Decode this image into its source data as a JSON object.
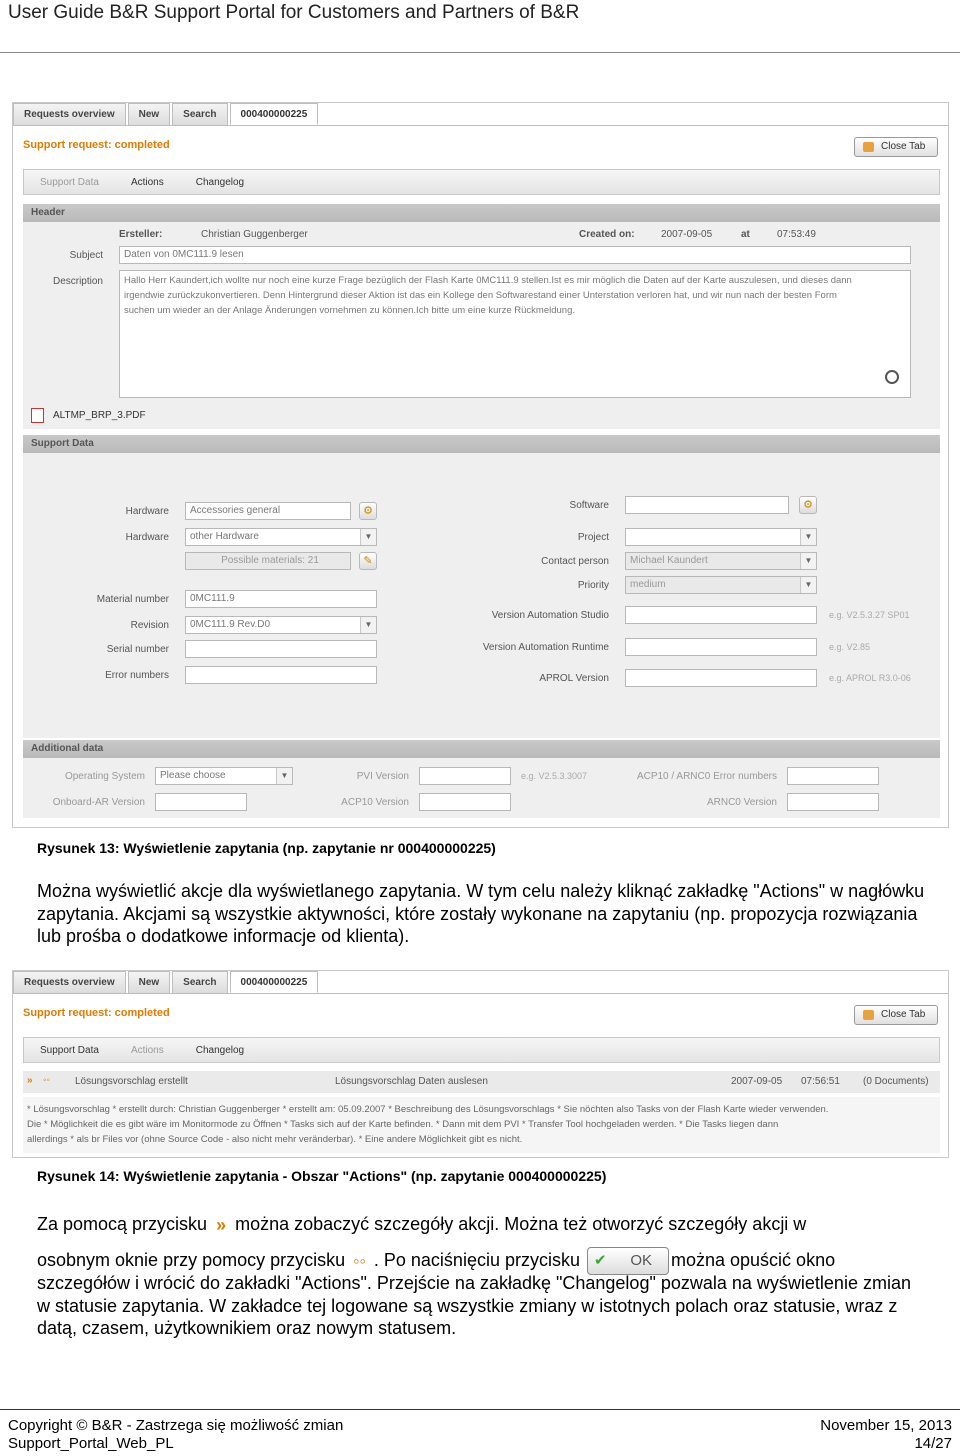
{
  "page_header": "User Guide B&R Support Portal for Customers and Partners of B&R",
  "shot1": {
    "tabs": [
      "Requests overview",
      "New",
      "Search",
      "000400000225"
    ],
    "title": "Support request: completed",
    "close_tab": "Close Tab",
    "subtabs": [
      "Support Data",
      "Actions",
      "Changelog"
    ],
    "header": {
      "bar": "Header",
      "ersteller_label": "Ersteller:",
      "ersteller_value": "Christian Guggenberger",
      "created_label": "Created on:",
      "created_date": "2007-09-05",
      "at_label": "at",
      "created_time": "07:53:49",
      "subject_label": "Subject",
      "subject_value": "Daten von 0MC111.9 lesen",
      "description_label": "Description",
      "description_lines": [
        "Hallo Herr Kaundert,ich wollte nur noch eine kurze Frage bezüglich der Flash Karte 0MC111.9 stellen.Ist es mir möglich die Daten auf der Karte auszulesen, und dieses dann",
        "irgendwie zurückzukonvertieren. Denn Hintergrund dieser Aktion ist das ein Kollege den Softwarestand einer Unterstation verloren hat, und wir nun nach der besten Form",
        "suchen um wieder an der Anlage Änderungen vornehmen zu können.Ich bitte um eine kurze Rückmeldung."
      ],
      "attachment": "ALTMP_BRP_3.PDF"
    },
    "support": {
      "bar": "Support Data",
      "hardware1_label": "Hardware",
      "hardware1_value": "Accessories general",
      "hardware2_label": "Hardware",
      "hardware2_value": "other Hardware",
      "possible_materials": "Possible materials: 21",
      "material_label": "Material number",
      "material_value": "0MC111.9",
      "revision_label": "Revision",
      "revision_value": "0MC111.9 Rev.D0",
      "serial_label": "Serial number",
      "error_label": "Error numbers",
      "software_label": "Software",
      "project_label": "Project",
      "contact_label": "Contact person",
      "contact_value": "Michael Kaundert",
      "priority_label": "Priority",
      "priority_value": "medium",
      "vas_label": "Version Automation Studio",
      "vas_hint": "e.g. V2.5.3.27 SP01",
      "var_label": "Version Automation Runtime",
      "var_hint": "e.g. V2.85",
      "aprol_label": "APROL Version",
      "aprol_hint": "e.g. APROL R3.0-06"
    },
    "additional": {
      "bar": "Additional data",
      "os_label": "Operating System",
      "os_value": "Please choose",
      "pvi_label": "PVI Version",
      "pvi_hint": "e.g. V2.5.3.3007",
      "acp_err_label": "ACP10 / ARNC0 Error numbers",
      "onboard_label": "Onboard-AR Version",
      "acp_label": "ACP10 Version",
      "arnc_label": "ARNC0 Version"
    }
  },
  "caption1": "Rysunek 13: Wyświetlenie zapytania (np. zapytanie nr 000400000225)",
  "para1": "Można wyświetlić akcje dla wyświetlanego zapytania. W tym celu należy kliknąć zakładkę \"Actions\" w nagłówku zapytania. Akcjami są wszystkie aktywności, które zostały wykonane na zapytaniu (np. propozycja rozwiązania lub prośba o dodatkowe informacje od klienta).",
  "shot2": {
    "tabs": [
      "Requests overview",
      "New",
      "Search",
      "000400000225"
    ],
    "title": "Support request: completed",
    "close_tab": "Close Tab",
    "subtabs": [
      "Support Data",
      "Actions",
      "Changelog"
    ],
    "action_type": "Lösungsvorschlag erstellt",
    "action_desc": "Lösungsvorschlag Daten auslesen",
    "action_date": "2007-09-05",
    "action_time": "07:56:51",
    "action_docs": "(0 Documents)",
    "detail_lines": [
      "* Lösungsvorschlag *   erstellt durch:   Christian Guggenberger *   erstellt am:        05.09.2007 * Beschreibung des Lösungsvorschlags * Sie nöchten also Tasks von der Flash Karte wieder verwenden.",
      "Die * Möglichkeit die es gibt wäre im Monitormode zu Öffnen * Tasks sich auf der Karte befinden. * Dann mit dem PVI * Transfer Tool hochgeladen werden. * Die Tasks liegen dann",
      "allerdings * als br Files vor (ohne Source Code - also nicht mehr veränderbar). * Eine andere Möglichkeit gibt es nicht."
    ]
  },
  "caption2": "Rysunek 14: Wyświetlenie zapytania - Obszar \"Actions\" (np. zapytanie 000400000225)",
  "para2": {
    "t1": "Za pomocą przycisku",
    "t2": "można zobaczyć szczegóły akcji. Można też otworzyć szczegóły akcji w",
    "t3": "osobnym oknie przy pomocy przycisku",
    "t4": ". Po naciśnięciu przycisku",
    "ok_label": "OK",
    "t5": "można opuścić okno",
    "rest": "szczegółów i wrócić do zakładki \"Actions\". Przejście na zakładkę \"Changelog\" pozwala na wyświetlenie zmian w statusie zapytania. W zakładce tej logowane są wszystkie zmiany w istotnych polach oraz statusie, wraz z datą, czasem, użytkownikiem oraz nowym statusem."
  },
  "footer": {
    "copyright": "Copyright © B&R - Zastrzega się możliwość zmian",
    "date": "November 15, 2013",
    "doc_id": "Support_Portal_Web_PL",
    "page": "14/27"
  }
}
